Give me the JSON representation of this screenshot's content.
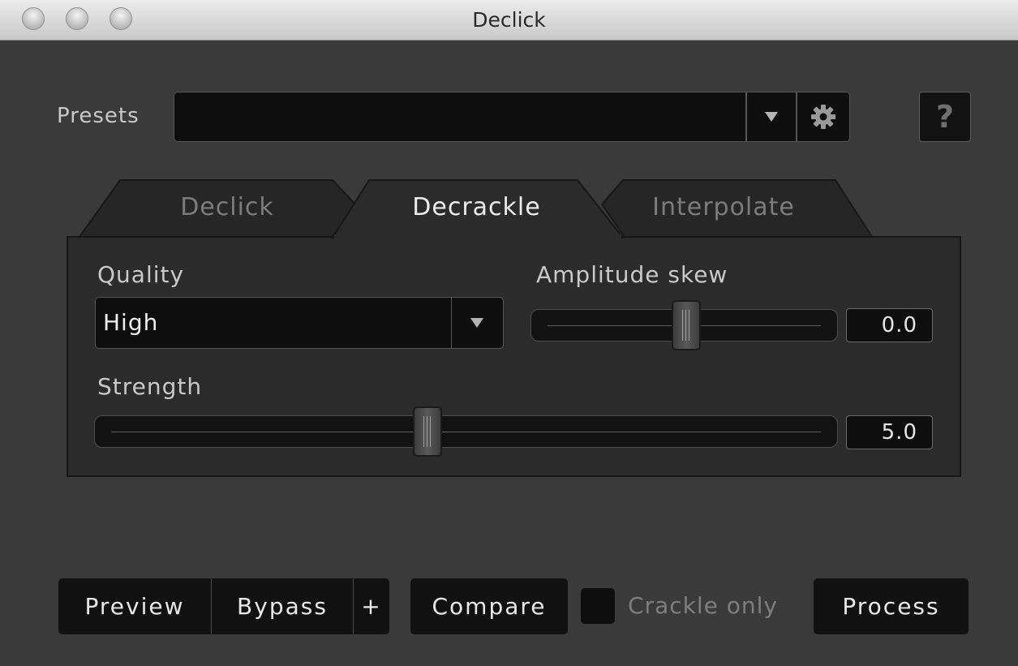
{
  "window": {
    "title": "Declick"
  },
  "presets": {
    "label": "Presets",
    "value": "",
    "dropdown_icon": "triangle-down-icon",
    "settings_icon": "gear-icon",
    "help_label": "?"
  },
  "tabs": [
    {
      "label": "Declick",
      "active": false
    },
    {
      "label": "Decrackle",
      "active": true
    },
    {
      "label": "Interpolate",
      "active": false
    }
  ],
  "panel": {
    "quality": {
      "label": "Quality",
      "value": "High"
    },
    "amplitude_skew": {
      "label": "Amplitude skew",
      "value": "0.0"
    },
    "strength": {
      "label": "Strength",
      "value": "5.0"
    }
  },
  "bottom_bar": {
    "preview": "Preview",
    "bypass": "Bypass",
    "plus": "+",
    "compare": "Compare",
    "crackle_only": "Crackle only",
    "crackle_only_checked": false,
    "process": "Process"
  },
  "colors": {
    "background": "#3a3a3a",
    "field": "#0e0e0e",
    "active_tab": "#2b2b2b",
    "inactive_tab": "#262626",
    "text": "#c9c9c9"
  }
}
